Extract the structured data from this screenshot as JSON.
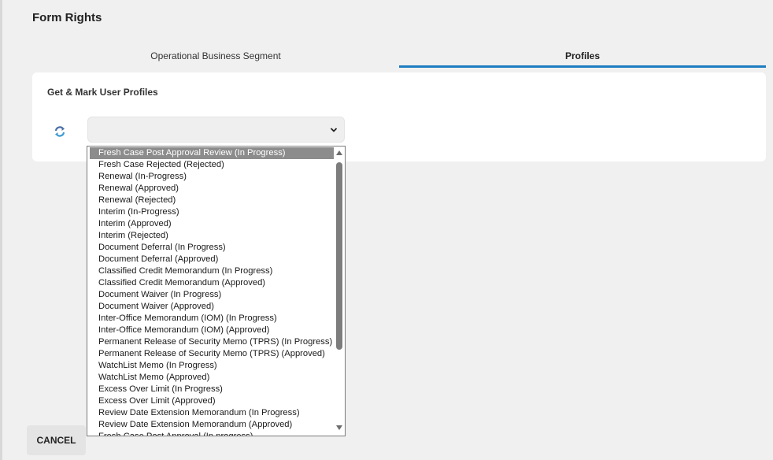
{
  "page": {
    "title": "Form Rights"
  },
  "tabs": [
    {
      "label": "Operational Business Segment"
    },
    {
      "label": "Profiles"
    }
  ],
  "card": {
    "title": "Get & Mark User Profiles",
    "select_value": ""
  },
  "colors": {
    "accent": "#1d7ec1",
    "selected_option_bg": "#8c8c8c"
  },
  "icons": {
    "refresh": "refresh-icon",
    "select_arrow": "chevron-down-icon"
  },
  "dropdown": {
    "options": [
      "Fresh Case Post Approval Review (In Progress)",
      "Fresh Case Rejected (Rejected)",
      "Renewal (In-Progress)",
      "Renewal (Approved)",
      "Renewal (Rejected)",
      "Interim (In-Progress)",
      "Interim (Approved)",
      "Interim (Rejected)",
      "Document Deferral (In Progress)",
      "Document Deferral (Approved)",
      "Classified Credit Memorandum (In Progress)",
      "Classified Credit Memorandum (Approved)",
      "Document Waiver (In Progress)",
      "Document Waiver (Approved)",
      "Inter-Office Memorandum (IOM) (In Progress)",
      "Inter-Office Memorandum (IOM) (Approved)",
      "Permanent Release of Security Memo (TPRS) (In Progress)",
      "Permanent Release of Security Memo (TPRS) (Approved)",
      "WatchList Memo (In Progress)",
      "WatchList Memo (Approved)",
      "Excess Over Limit (In Progress)",
      "Excess Over Limit (Approved)",
      "Review Date Extension Memorandum (In Progress)",
      "Review Date Extension Memorandum (Approved)",
      "Fresh Case Post Approval (In progress)"
    ]
  },
  "footer": {
    "cancel_label": "CANCEL"
  }
}
